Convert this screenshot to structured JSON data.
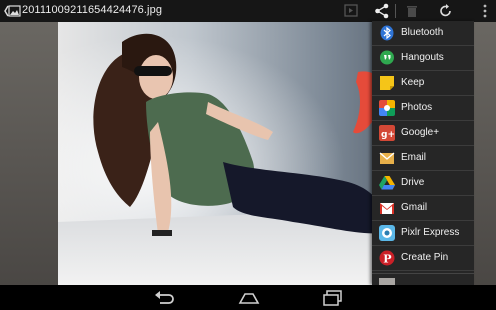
{
  "actionbar": {
    "title": "20111009211654424476.jpg",
    "icons": [
      "gallery-home-icon",
      "slideshow-icon",
      "share-icon",
      "delete-icon",
      "rotate-icon",
      "overflow-menu-icon"
    ]
  },
  "share_menu": {
    "items": [
      {
        "label": "Bluetooth",
        "icon": "bluetooth-icon",
        "color": "#2f74d6"
      },
      {
        "label": "Hangouts",
        "icon": "hangouts-icon",
        "color": "#2fa84f"
      },
      {
        "label": "Keep",
        "icon": "keep-icon",
        "color": "#f5c518"
      },
      {
        "label": "Photos",
        "icon": "photos-icon",
        "color": "#e44d3a"
      },
      {
        "label": "Google+",
        "icon": "google-plus-icon",
        "color": "#d34836"
      },
      {
        "label": "Email",
        "icon": "email-icon",
        "color": "#e8b04a"
      },
      {
        "label": "Drive",
        "icon": "drive-icon",
        "color": "#1fa463"
      },
      {
        "label": "Gmail",
        "icon": "gmail-icon",
        "color": "#d93025"
      },
      {
        "label": "Pixlr Express",
        "icon": "pixlr-express-icon",
        "color": "#5bb8e8"
      },
      {
        "label": "Create Pin",
        "icon": "pinterest-icon",
        "color": "#cb2027"
      }
    ]
  },
  "navbar": {
    "icons": [
      "back-icon",
      "home-icon",
      "recent-apps-icon"
    ]
  }
}
